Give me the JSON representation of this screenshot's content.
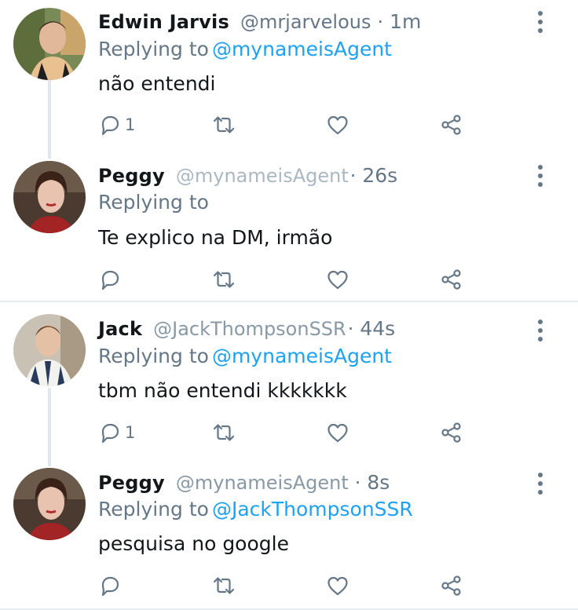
{
  "colors": {
    "text": "#14171a",
    "secondary": "#657786",
    "link": "#1da1f2",
    "line": "#e1e8ed"
  },
  "tweets": [
    {
      "name": "Edwin Jarvis",
      "handle": "@mrjarvelous",
      "separator": "·",
      "time": "1m",
      "replying_label": "Replying to",
      "replying_to": "@mynameisAgent",
      "text": "não entendi",
      "reply_count": "1",
      "avatar": "avatar-edwin-jarvis"
    },
    {
      "name": "Peggy",
      "handle": "@mynameisAgent",
      "separator": "·",
      "time": "26s",
      "replying_label": "Replying to",
      "replying_to": "",
      "text": "Te explico na DM, irmão",
      "reply_count": "",
      "avatar": "avatar-peggy"
    },
    {
      "name": "Jack",
      "handle": "@JackThompsonSSR",
      "separator": "·",
      "time": "44s",
      "replying_label": "Replying to",
      "replying_to": "@mynameisAgent",
      "text": "tbm não entendi kkkkkkk",
      "reply_count": "1",
      "avatar": "avatar-jack"
    },
    {
      "name": "Peggy",
      "handle": "@mynameisAgent",
      "separator": "·",
      "time": "8s",
      "replying_label": "Replying to",
      "replying_to": "@JackThompsonSSR",
      "text": "pesquisa no google",
      "reply_count": "",
      "avatar": "avatar-peggy"
    }
  ],
  "icons": {
    "reply": "reply-icon",
    "retweet": "retweet-icon",
    "like": "heart-icon",
    "share": "share-icon",
    "more": "more-vertical-icon"
  }
}
